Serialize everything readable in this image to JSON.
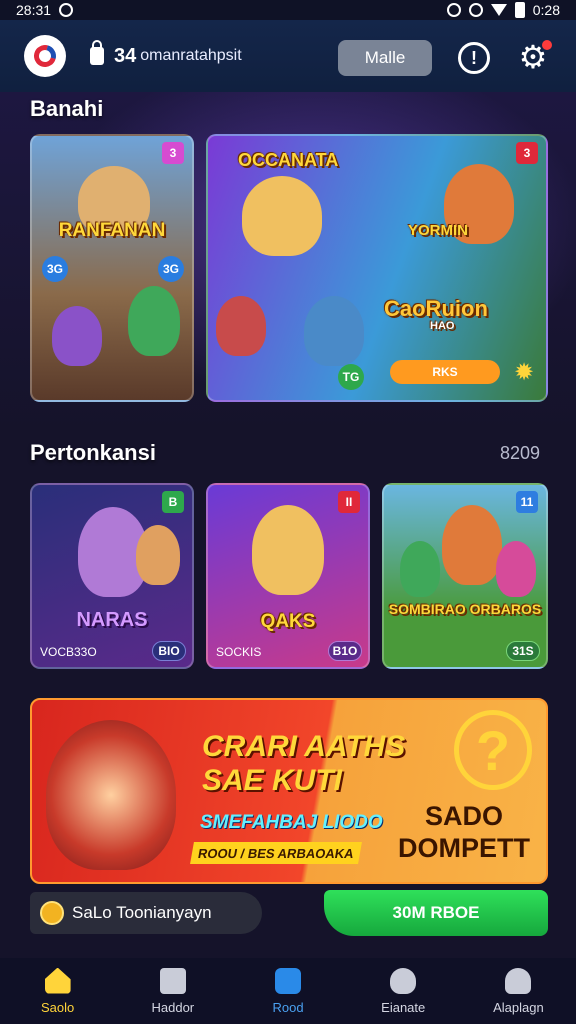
{
  "status_bar": {
    "time": "28:31",
    "right_text": "0:28"
  },
  "header": {
    "user_id": "34",
    "user_name": "omanratahpsit",
    "mail_label": "Malle"
  },
  "featured": {
    "title": "Banahi",
    "cards": [
      {
        "title": "RANFANAN",
        "badge": "3",
        "pill_left": "3G",
        "pill_right": "3G",
        "badge_color": "#d64bd1"
      },
      {
        "title": "OCCANATA",
        "badge": "",
        "pill": "TG",
        "badge_color": "#9a4bd6"
      },
      {
        "title": "YORMIN",
        "subtitle": "CaoRuion",
        "sub2": "HAO",
        "badge": "3",
        "button": "RKS",
        "badge_color": "#e0283a"
      }
    ]
  },
  "popular": {
    "title": "Pertonkansi",
    "count": "8209",
    "cards": [
      {
        "title": "NARAS",
        "badge": "B",
        "footer_left": "VOCB33O",
        "footer_right": "BIO",
        "badge_color": "#2ea84c"
      },
      {
        "title": "QAKS",
        "badge": "II",
        "footer_left": "SOCKIS",
        "footer_right": "B1O",
        "badge_color": "#e0283a"
      },
      {
        "title": "SOMBIRAO ORBAROS",
        "badge": "11",
        "footer_right": "31S",
        "badge_color": "#2e7de0"
      }
    ]
  },
  "promo": {
    "title_line1": "CRARI AATHS",
    "title_line2": "SAE KUTI",
    "subtitle": "SMEFAHBAJ LIODO",
    "strip": "ROOU / BES ARBAOAKA",
    "right_title_line1": "SADO",
    "right_title_line2": "DOMPETT"
  },
  "actions": {
    "wallet_label": "SaLo Toonianyayn",
    "cta_label": "30M RBOE"
  },
  "nav": [
    {
      "label": "Saolo",
      "icon": "home-icon"
    },
    {
      "label": "Haddor",
      "icon": "bag-icon"
    },
    {
      "label": "Rood",
      "icon": "square-icon"
    },
    {
      "label": "Eianate",
      "icon": "controller-icon"
    },
    {
      "label": "Alaplagn",
      "icon": "profile-icon"
    }
  ],
  "colors": {
    "accent": "#ffd43a",
    "cta": "#22c34a",
    "header": "#12234a",
    "background": "#15132a"
  }
}
